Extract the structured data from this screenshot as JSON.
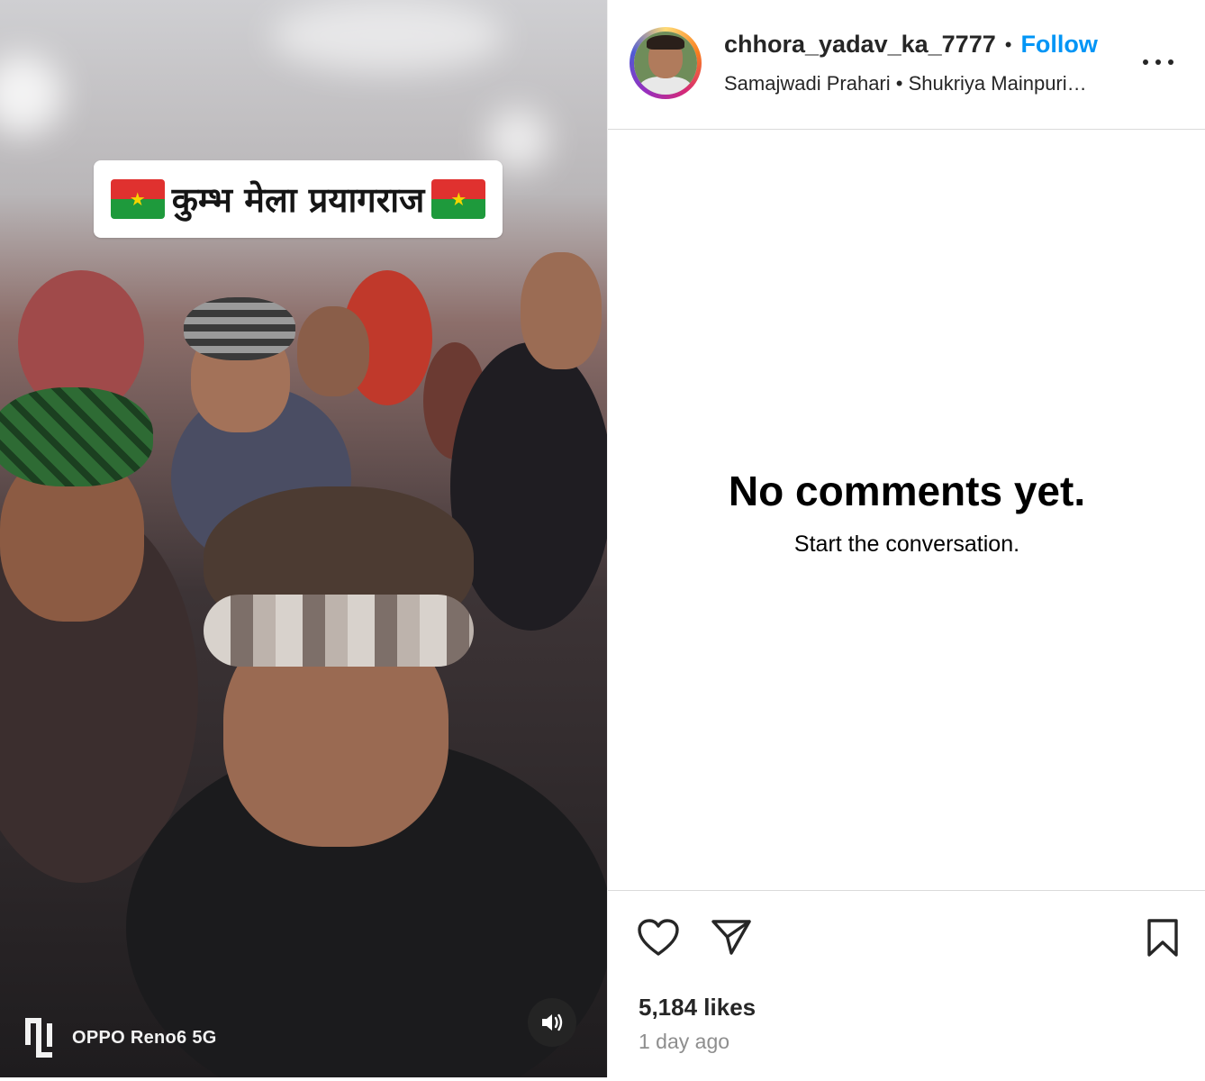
{
  "media": {
    "caption": "कुम्भ मेला प्रयागराज",
    "watermark": "OPPO Reno6 5G",
    "flag_icon": "burkina-faso-flag-emoji",
    "volume_icon": "speaker-icon"
  },
  "header": {
    "username": "chhora_yadav_ka_7777",
    "separator": "•",
    "follow_label": "Follow",
    "subtitle": "Samajwadi Prahari • Shukriya Mainpuri…"
  },
  "comments": {
    "empty_title": "No comments yet.",
    "empty_sub": "Start the conversation."
  },
  "footer": {
    "likes": "5,184 likes",
    "time": "1 day ago"
  },
  "colors": {
    "accent": "#0095f6",
    "text": "#262626",
    "muted": "#8e8e8e",
    "divider": "#dbdbdb"
  }
}
